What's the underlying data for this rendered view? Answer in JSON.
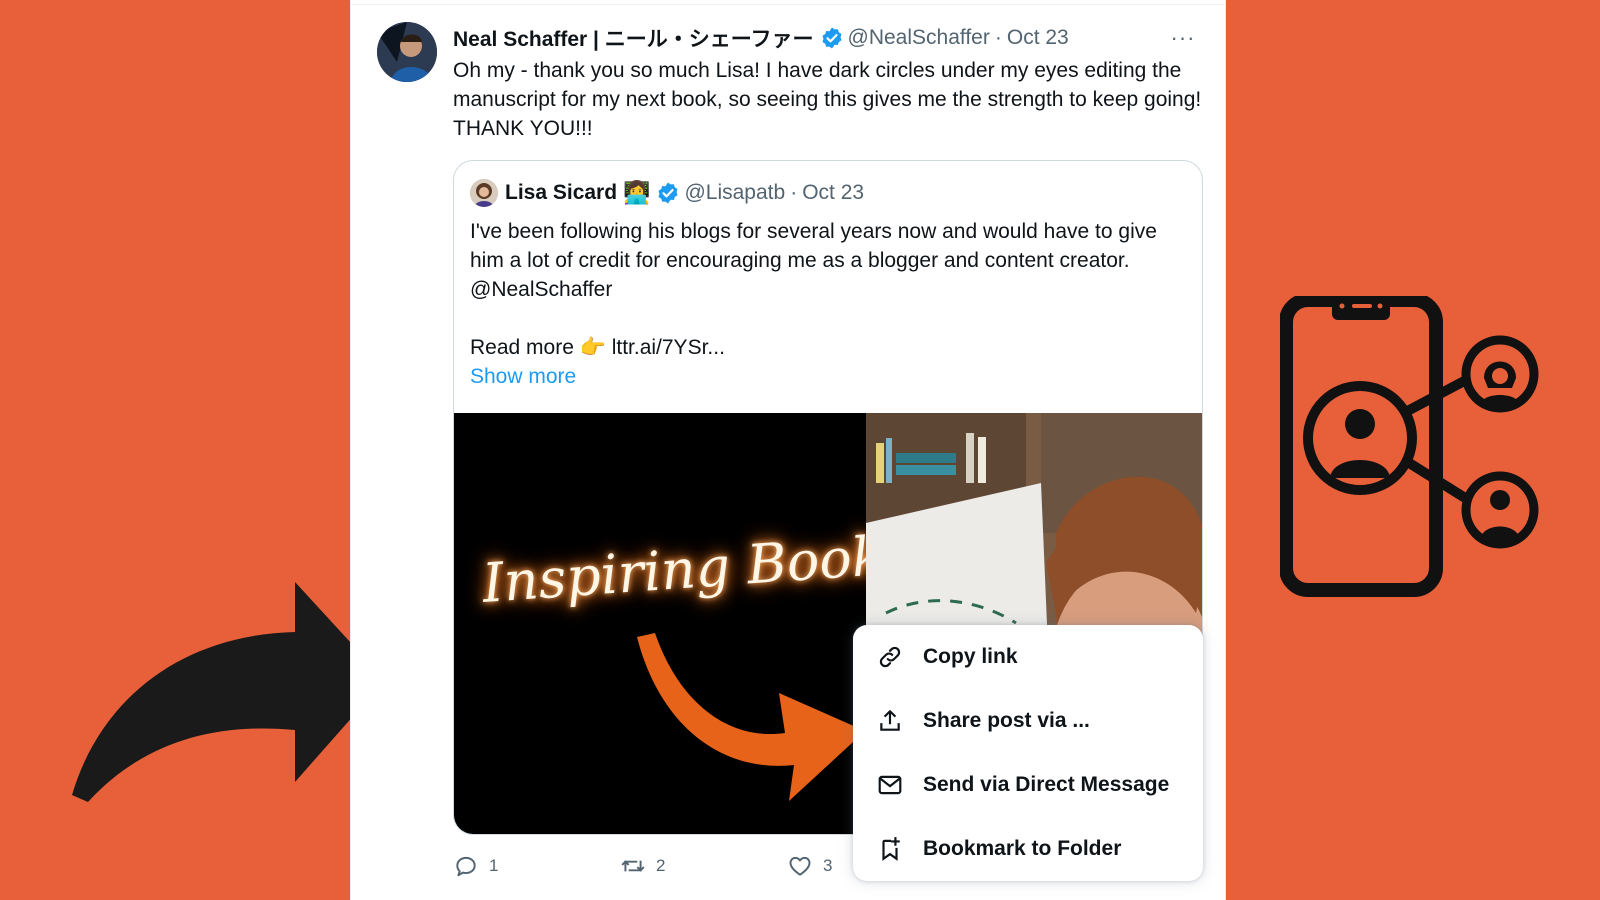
{
  "tweet": {
    "author_name": "Neal Schaffer | ニール・シェーファー",
    "handle": "@NealSchaffer",
    "separator": "·",
    "date": "Oct 23",
    "more_label": "···",
    "text": "Oh my - thank you so much Lisa! I have dark circles under my eyes editing the manuscript for my next book, so seeing this gives me the strength to keep going! THANK YOU!!!"
  },
  "quote": {
    "author_name": "Lisa Sicard",
    "emoji": "👩‍💻",
    "handle": "@Lisapatb",
    "separator": "·",
    "date": "Oct 23",
    "text_line1": "I've been following his blogs for several years now and would have to give him a lot of credit for encouraging me as a blogger and content creator. @NealSchaffer",
    "text_line2": "",
    "read_more": "Read more 👉 lttr.ai/7YSr...",
    "show_more": "Show more",
    "media_overlay_text": "Inspiring Book"
  },
  "actions": {
    "replies": "1",
    "reposts": "2",
    "likes": "3"
  },
  "menu": {
    "items": [
      {
        "label": "Copy link",
        "icon": "link-icon"
      },
      {
        "label": "Share post via ...",
        "icon": "share-icon"
      },
      {
        "label": "Send via Direct Message",
        "icon": "envelope-icon"
      },
      {
        "label": "Bookmark to Folder",
        "icon": "bookmark-plus-icon"
      }
    ]
  },
  "colors": {
    "background": "#E8603A",
    "verified_blue": "#1D9BF0",
    "link_blue": "#1D9BF0",
    "muted_text": "#536471",
    "arrow_orange": "#E8631A"
  }
}
